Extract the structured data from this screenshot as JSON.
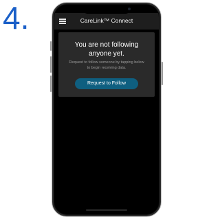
{
  "step": {
    "number": "4."
  },
  "app": {
    "title": "CareLink™ Connect",
    "menu_icon": "hamburger-menu-icon"
  },
  "empty_state": {
    "headline_line1": "You are not following",
    "headline_line2": "anyone yet.",
    "subtext_line1": "Request to follow someone by tapping below",
    "subtext_line2": "to begin receiving data.",
    "button_label": "Request to Follow"
  },
  "colors": {
    "step_number": "#1a5fc8",
    "header_bg": "#1e1e1e",
    "panel_bg": "#2a2a2a",
    "button_bg": "#0f5f80",
    "screen_bg": "#000000"
  }
}
